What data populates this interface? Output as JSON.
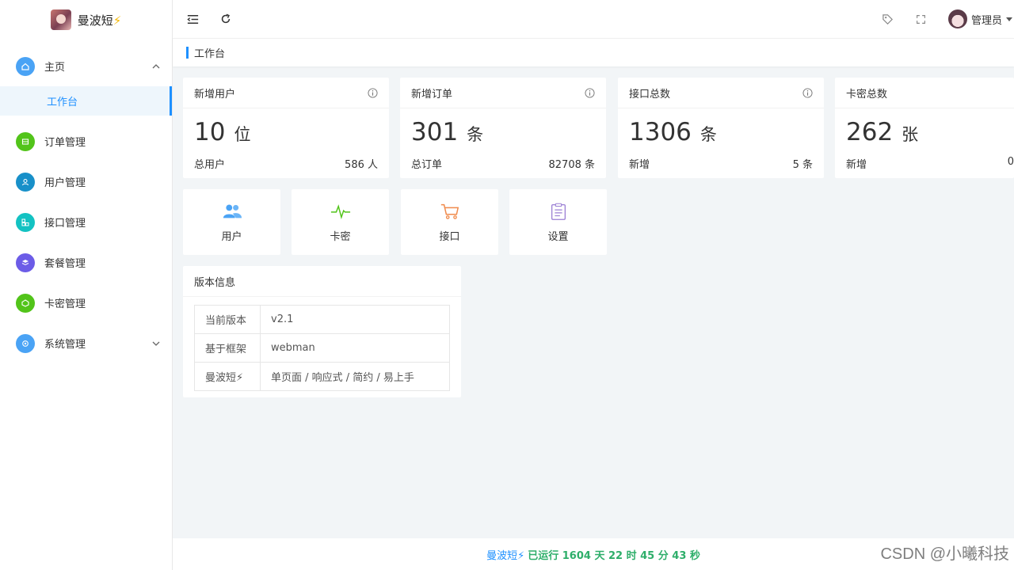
{
  "brand": {
    "name": "曼波短",
    "bolt": "⚡"
  },
  "sidebar": {
    "items": [
      {
        "label": "主页",
        "color": "#4aa3f5",
        "icon": "home-icon"
      },
      {
        "label": "订单管理",
        "color": "#52c41a",
        "icon": "list-icon"
      },
      {
        "label": "用户管理",
        "color": "#1890c9",
        "icon": "user-icon"
      },
      {
        "label": "接口管理",
        "color": "#13c2c2",
        "icon": "api-icon"
      },
      {
        "label": "套餐管理",
        "color": "#6c5ce7",
        "icon": "package-icon"
      },
      {
        "label": "卡密管理",
        "color": "#52c41a",
        "icon": "card-icon"
      },
      {
        "label": "系统管理",
        "color": "#4aa3f5",
        "icon": "settings-icon"
      }
    ],
    "sub_item": "工作台"
  },
  "topbar": {
    "user_name": "管理员"
  },
  "tab": {
    "label": "工作台"
  },
  "stats": [
    {
      "title": "新增用户",
      "value": "10",
      "unit": "位",
      "foot_label": "总用户",
      "foot_value": "586 人"
    },
    {
      "title": "新增订单",
      "value": "301",
      "unit": "条",
      "foot_label": "总订单",
      "foot_value": "82708 条"
    },
    {
      "title": "接口总数",
      "value": "1306",
      "unit": "条",
      "foot_label": "新增",
      "foot_value": "5 条"
    },
    {
      "title": "卡密总数",
      "value": "262",
      "unit": "张",
      "foot_label": "新增",
      "foot_value": "0"
    }
  ],
  "quick": [
    {
      "label": "用户",
      "icon": "users-icon",
      "color": "#4aa3f5"
    },
    {
      "label": "卡密",
      "icon": "pulse-icon",
      "color": "#52c41a"
    },
    {
      "label": "接口",
      "icon": "cart-icon",
      "color": "#f08a4b"
    },
    {
      "label": "设置",
      "icon": "clipboard-icon",
      "color": "#9b7fd4"
    }
  ],
  "version": {
    "title": "版本信息",
    "rows": [
      {
        "key": "当前版本",
        "value": "v2.1"
      },
      {
        "key": "基于框架",
        "value": "webman"
      },
      {
        "key": "曼波短⚡",
        "value": "单页面 / 响应式 / 简约 / 易上手"
      }
    ]
  },
  "footer": {
    "brand": "曼波短⚡",
    "running": "已运行 1604 天 22 时 45 分 43 秒"
  },
  "watermark": "CSDN @小曦科技"
}
